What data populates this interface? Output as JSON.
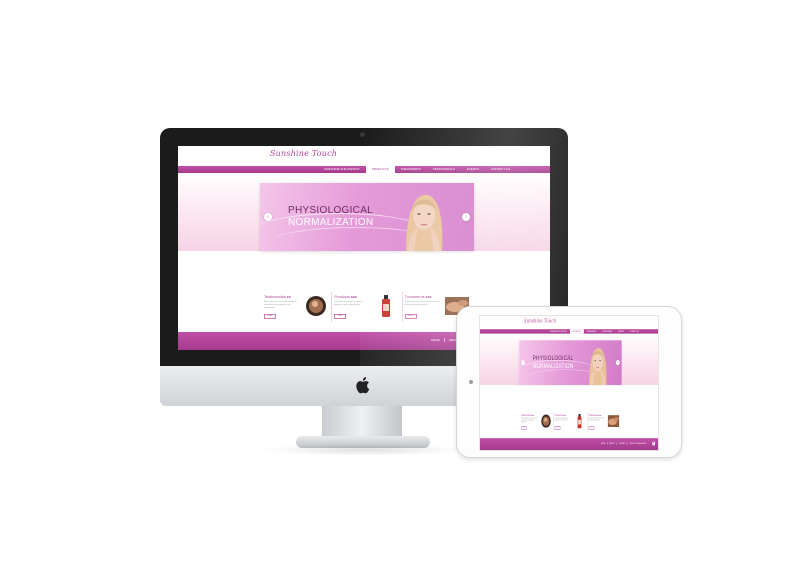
{
  "site": {
    "logo_text": "Sunshine Touch",
    "nav": [
      "SUNSHINE PHILOSOPHY",
      "PRODUCTS",
      "TREATMENTS",
      "TESTIMONIALS",
      "EVENTS",
      "CONTACT US"
    ],
    "active_nav_index": 1,
    "banner": {
      "line1": "PHYSIOLOGICAL",
      "line2": "NORMALIZATION",
      "prev": "‹",
      "next": "›"
    },
    "boxes": [
      {
        "title": "Testimonials",
        "arrows": "▸▸",
        "text": "Read what our customers have to say about our products and treatments.",
        "button": "more"
      },
      {
        "title": "Products",
        "arrows": "▸▸▸",
        "text": "Discover our range of natural products and essential oils.",
        "button": "more"
      },
      {
        "title": "Treatments",
        "arrows": "▸▸▸",
        "text": "Experience our relaxing treatments and massage therapies.",
        "button": "more"
      }
    ],
    "footer_links": [
      "HOME",
      "ABOUT",
      "CONTACT",
      "FIND US ON FACEBOOK"
    ],
    "facebook_glyph": "f"
  },
  "colors": {
    "brand": "#b5479b",
    "nav_bar": "#a23a8c",
    "banner_pink": "#e59ad8",
    "device_bezel": "#1b1b1b",
    "aluminum": "#d8dadd"
  },
  "icons": [
    "apple-logo-icon",
    "facebook-icon",
    "prev-arrow-icon",
    "next-arrow-icon"
  ]
}
